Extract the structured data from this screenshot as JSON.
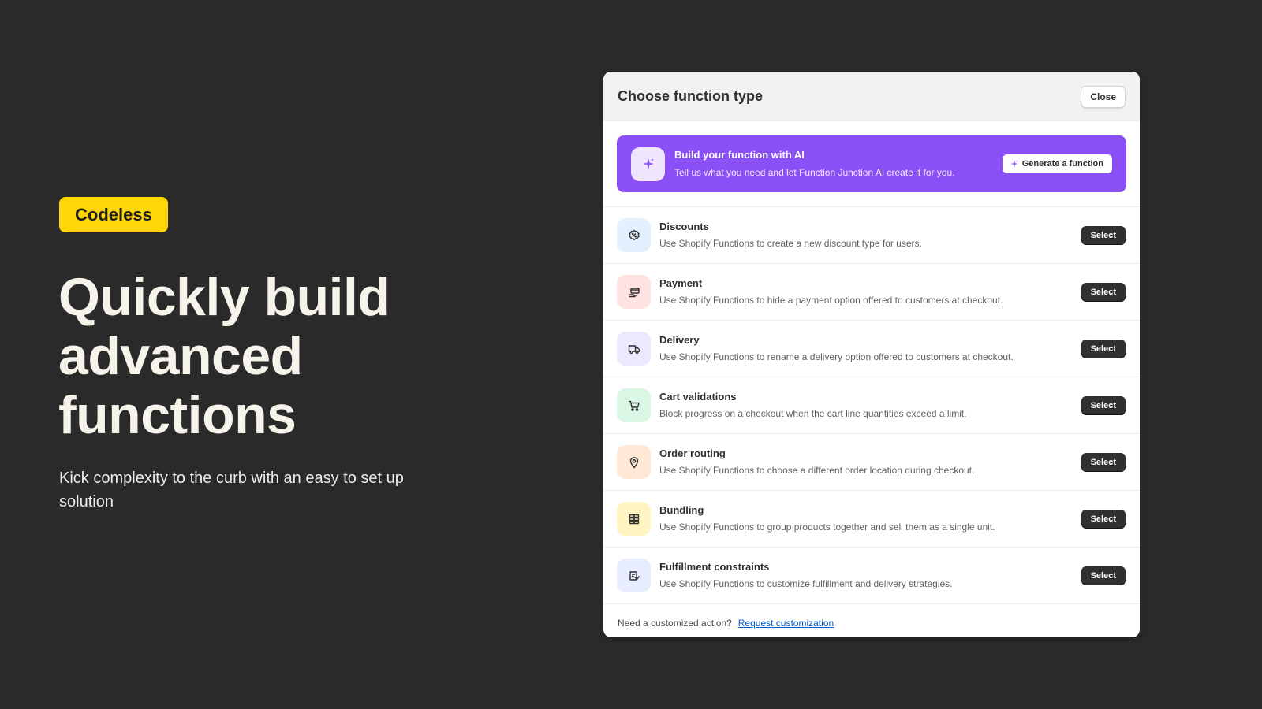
{
  "promo": {
    "badge": "Codeless",
    "headline": "Quickly build advanced functions",
    "subhead": "Kick complexity to the curb with an easy to set up solution"
  },
  "modal": {
    "title": "Choose function type",
    "close_label": "Close",
    "ai_banner": {
      "title": "Build your function with AI",
      "description": "Tell us what you need and let Function Junction AI create it for you.",
      "button_label": "Generate a function",
      "icon": "sparkle-icon",
      "color": "#8b50f5"
    },
    "functions": [
      {
        "name": "Discounts",
        "description": "Use Shopify Functions to create a new discount type for users.",
        "icon": "discount-icon",
        "icon_bg": "#e3f1ff",
        "select_label": "Select"
      },
      {
        "name": "Payment",
        "description": "Use Shopify Functions to hide a payment option offered to customers at checkout.",
        "icon": "payment-icon",
        "icon_bg": "#ffe3e3",
        "select_label": "Select"
      },
      {
        "name": "Delivery",
        "description": "Use Shopify Functions to rename a delivery option offered to customers at checkout.",
        "icon": "delivery-truck-icon",
        "icon_bg": "#ece8ff",
        "select_label": "Select"
      },
      {
        "name": "Cart validations",
        "description": "Block progress on a checkout when the cart line quantities exceed a limit.",
        "icon": "cart-icon",
        "icon_bg": "#d9f7e4",
        "select_label": "Select"
      },
      {
        "name": "Order routing",
        "description": "Use Shopify Functions to choose a different order location during checkout.",
        "icon": "location-pin-icon",
        "icon_bg": "#ffe9d6",
        "select_label": "Select"
      },
      {
        "name": "Bundling",
        "description": "Use Shopify Functions to group products together and sell them as a single unit.",
        "icon": "bundle-icon",
        "icon_bg": "#fff4c2",
        "select_label": "Select"
      },
      {
        "name": "Fulfillment constraints",
        "description": "Use Shopify Functions to customize fulfillment and delivery strategies.",
        "icon": "fulfillment-icon",
        "icon_bg": "#e8ecff",
        "select_label": "Select"
      }
    ],
    "footer": {
      "prompt": "Need a customized action?",
      "link_label": "Request customization"
    }
  }
}
